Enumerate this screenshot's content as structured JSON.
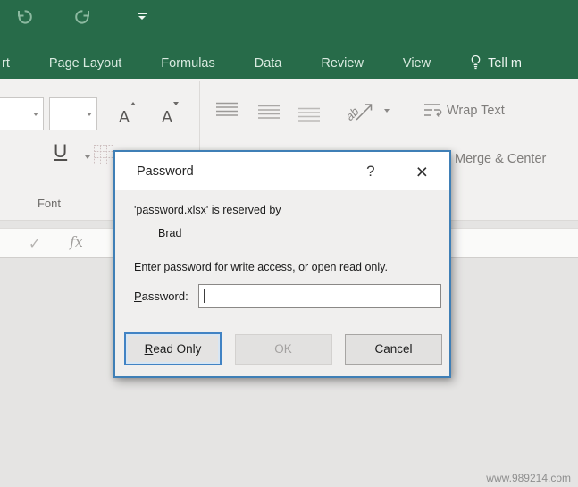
{
  "header": {
    "tabs": [
      "rt",
      "Page Layout",
      "Formulas",
      "Data",
      "Review",
      "View",
      "Tell m"
    ]
  },
  "ribbon": {
    "font_group_label": "Font",
    "underline_glyph": "U",
    "grow_font_glyph": "A",
    "shrink_font_glyph": "A",
    "orientation_glyph": "ab",
    "wrap_text_label": "Wrap Text",
    "merge_center_label": "Merge & Center"
  },
  "formula_bar": {
    "confirm_glyph": "✓",
    "fx_glyph": "fx"
  },
  "dialog": {
    "title": "Password",
    "help_glyph": "?",
    "close_glyph": "×",
    "reserved_line": "'password.xlsx' is reserved by",
    "owner": "Brad",
    "prompt": "Enter password for write access, or open read only.",
    "password_label": "Password:",
    "password_value": "",
    "read_only_label": "Read Only",
    "ok_label": "OK",
    "cancel_label": "Cancel"
  },
  "watermark": "www.989214.com",
  "colors": {
    "excel_green": "#276b49",
    "ribbon_bg": "#f2f1f0",
    "dialog_border": "#3f7fb6",
    "focus_blue": "#4183c4",
    "disabled_text": "#a3a1a0"
  }
}
